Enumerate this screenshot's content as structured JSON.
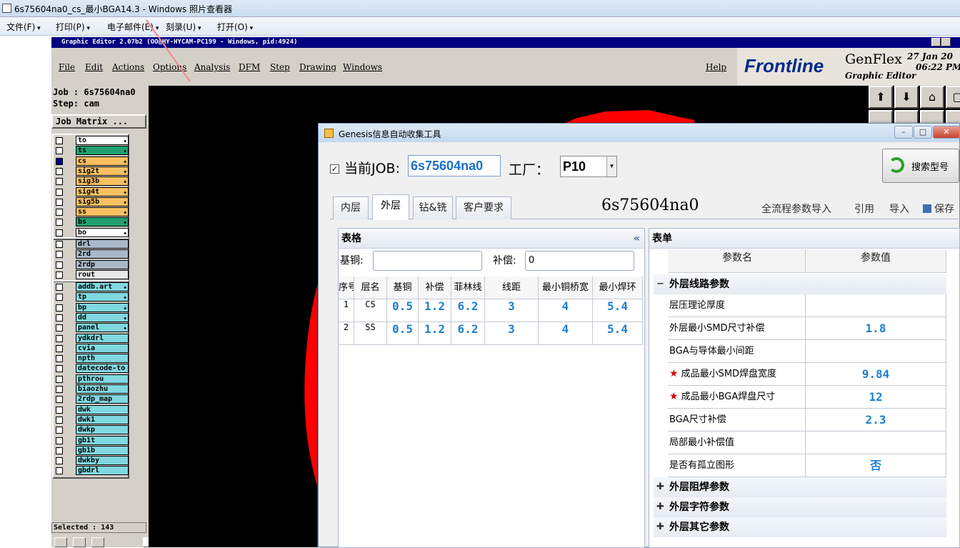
{
  "photo_viewer": {
    "title": "6s75604na0_cs_最小BGA14.3 - Windows 照片查看器",
    "menu": [
      "文件(F)",
      "打印(P)",
      "电子邮件(E)",
      "刻录(U)",
      "打开(O)"
    ]
  },
  "genesis": {
    "title": "Graphic Editor 2.07b2 (OO@HY-HYCAM-PC199 - Windows, pid:4924)",
    "menu": [
      "File",
      "Edit",
      "Actions",
      "Options",
      "Analysis",
      "DFM",
      "Step",
      "Drawing",
      "Windows"
    ],
    "help": "Help",
    "logo": "Frontline",
    "product": "GenFlex",
    "product_sub": "Graphic Editor",
    "date": "27 Jan 20",
    "time": "06:22 PM",
    "job_line": "Job : 6s75604na0",
    "step_line": "Step: cam",
    "job_matrix": "Job Matrix ...",
    "selected": "Selected : 143",
    "layer_groups": [
      {
        "layers": [
          {
            "name": "to",
            "color": "#ffffff"
          },
          {
            "name": "ts",
            "color": "#20a070"
          },
          {
            "name": "cs",
            "color": "#f8c060"
          },
          {
            "name": "sig2t",
            "color": "#f8c060"
          },
          {
            "name": "sig3b",
            "color": "#f8c060"
          },
          {
            "name": "sig4t",
            "color": "#f8c060"
          },
          {
            "name": "sig5b",
            "color": "#f8c060"
          },
          {
            "name": "ss",
            "color": "#f8c060"
          },
          {
            "name": "bs",
            "color": "#20a070"
          },
          {
            "name": "bo",
            "color": "#ffffff"
          }
        ]
      },
      {
        "layers": [
          {
            "name": "drl",
            "color": "#a8b8c8"
          },
          {
            "name": "2rd",
            "color": "#a8b8c8"
          },
          {
            "name": "2rdp",
            "color": "#a8b8c8"
          },
          {
            "name": "rout",
            "color": "#e8e8e8"
          }
        ]
      },
      {
        "layers": [
          {
            "name": "addb.art",
            "color": "#80d8e0"
          },
          {
            "name": "tp",
            "color": "#80d8e0"
          },
          {
            "name": "bp",
            "color": "#80d8e0"
          },
          {
            "name": "dd",
            "color": "#80d8e0"
          },
          {
            "name": "panel",
            "color": "#80d8e0"
          },
          {
            "name": "ydkdrl",
            "color": "#80d8e0"
          },
          {
            "name": "cvia",
            "color": "#80d8e0"
          },
          {
            "name": "npth",
            "color": "#80d8e0"
          },
          {
            "name": "datecode-to",
            "color": "#80d8e0"
          },
          {
            "name": "pthrou",
            "color": "#80d8e0"
          },
          {
            "name": "biaozhu",
            "color": "#80d8e0"
          },
          {
            "name": "2rdp_map",
            "color": "#80d8e0"
          },
          {
            "name": "dwk",
            "color": "#80d8e0"
          },
          {
            "name": "dwk1",
            "color": "#80d8e0"
          },
          {
            "name": "dwkp",
            "color": "#80d8e0"
          },
          {
            "name": "gb1t",
            "color": "#80d8e0"
          },
          {
            "name": "gb1b",
            "color": "#80d8e0"
          },
          {
            "name": "dwkby",
            "color": "#80d8e0"
          },
          {
            "name": "gbdrl",
            "color": "#80d8e0"
          }
        ]
      }
    ]
  },
  "tool": {
    "title": "Genesis信息自动收集工具",
    "current_job_label": "当前JOB:",
    "current_job_value": "6s75604na0",
    "factory_label": "工厂：",
    "factory_value": "P10",
    "search_button": "搜索型号",
    "tabs": [
      "内层",
      "外层",
      "钻&铣",
      "客户要求"
    ],
    "active_tab": "外层",
    "job_title": "6s75604na0",
    "actions": [
      "全流程参数导入",
      "引用",
      "导入",
      "保存"
    ],
    "table_panel": {
      "title": "表格",
      "collapse": "«",
      "base_copper_label": "基铜:",
      "base_copper_value": "",
      "compensation_label": "补偿:",
      "compensation_value": "0",
      "columns": [
        "序号",
        "层名",
        "基铜",
        "补偿",
        "菲林线",
        "线距",
        "最小铜桥宽",
        "最小焊环"
      ],
      "rows": [
        [
          "1",
          "CS",
          "0.5",
          "1.2",
          "6.2",
          "3",
          "4",
          "5.4"
        ],
        [
          "2",
          "SS",
          "0.5",
          "1.2",
          "6.2",
          "3",
          "4",
          "5.4"
        ]
      ]
    },
    "form_panel": {
      "title": "表单",
      "col_name": "参数名",
      "col_value": "参数值",
      "sections": [
        {
          "name": "外层线路参数",
          "expanded": true,
          "params": [
            {
              "name": "层压理论厚度",
              "value": "",
              "required": false
            },
            {
              "name": "外层最小SMD尺寸补偿",
              "value": "1.8",
              "required": false
            },
            {
              "name": "BGA与导体最小间距",
              "value": "",
              "required": false
            },
            {
              "name": "成品最小SMD焊盘宽度",
              "value": "9.84",
              "required": true
            },
            {
              "name": "成品最小BGA焊盘尺寸",
              "value": "12",
              "required": true
            },
            {
              "name": "BGA尺寸补偿",
              "value": "2.3",
              "required": false
            },
            {
              "name": "局部最小补偿值",
              "value": "",
              "required": false
            },
            {
              "name": "是否有孤立图形",
              "value": "否",
              "required": false
            }
          ]
        },
        {
          "name": "外层阻焊参数",
          "expanded": false
        },
        {
          "name": "外层字符参数",
          "expanded": false
        },
        {
          "name": "外层其它参数",
          "expanded": false
        }
      ]
    }
  }
}
